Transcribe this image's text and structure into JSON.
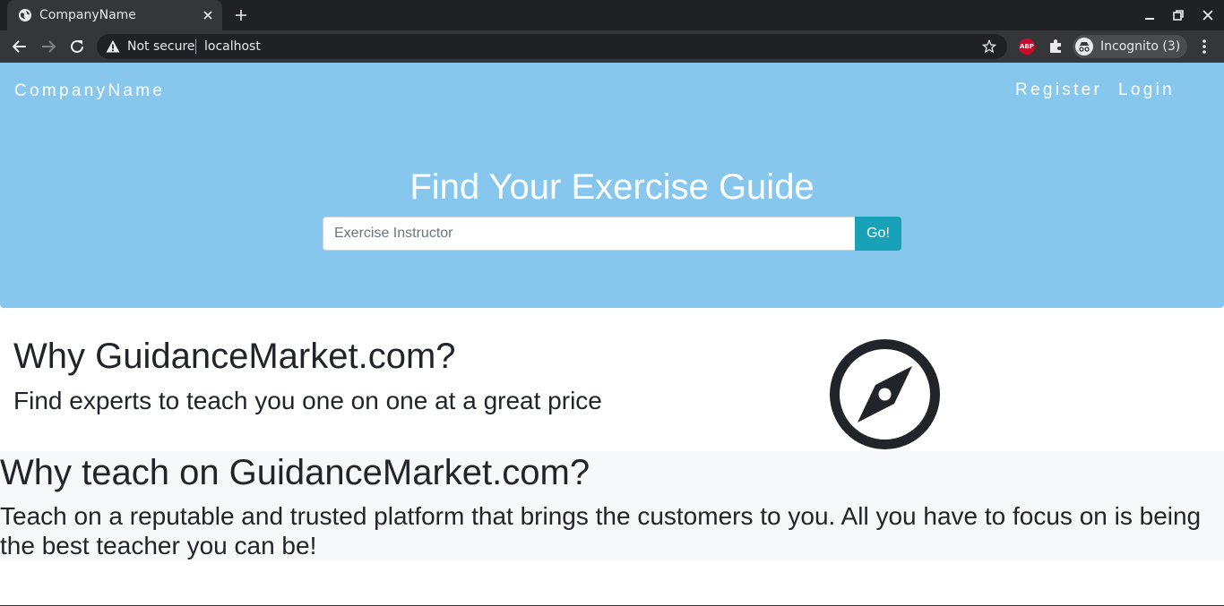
{
  "browser": {
    "tab_title": "CompanyName",
    "security_label": "Not secure",
    "url": "localhost",
    "extension_abp": "ABP",
    "incognito_label": "Incognito (3)"
  },
  "navbar": {
    "brand": "CompanyName",
    "links": [
      "Register",
      "Login"
    ]
  },
  "hero": {
    "title": "Find Your Exercise Guide",
    "search_placeholder": "Exercise Instructor",
    "search_value": "",
    "button_label": "Go!"
  },
  "why": {
    "title": "Why GuidanceMarket.com?",
    "text": "Find experts to teach you one on one at a great price",
    "icon": "compass-icon"
  },
  "teach": {
    "title": "Why teach on GuidanceMarket.com?",
    "text": "Teach on a reputable and trusted platform that brings the customers to you. All you have to focus on is being the best teacher you can be!"
  },
  "colors": {
    "hero_bg": "#87c7ee",
    "button_bg": "#17a2b8",
    "section_bg": "#f6f8fa",
    "text": "#212529"
  }
}
